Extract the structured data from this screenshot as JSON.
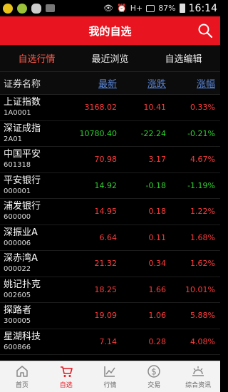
{
  "status_bar": {
    "battery": "87%",
    "time": "16:14",
    "network": "H+",
    "icons": [
      "warning-icon",
      "ball-icon",
      "wechat-icon",
      "image-icon",
      "eye-icon",
      "alarm-icon",
      "wifi-icon",
      "signal-icon",
      "battery-icon"
    ]
  },
  "header": {
    "title": "我的自选",
    "search_icon": "search-icon"
  },
  "tabs": [
    {
      "label": "自选行情",
      "active": true
    },
    {
      "label": "最近浏览",
      "active": false
    },
    {
      "label": "自选编辑",
      "active": false
    }
  ],
  "columns": {
    "name": "证券名称",
    "latest": "最新",
    "change": "涨跌",
    "change_pct": "涨幅"
  },
  "stocks": [
    {
      "name": "上证指数",
      "code": "1A0001",
      "latest": "3168.02",
      "change": "10.41",
      "pct": "0.33%",
      "dir": "up"
    },
    {
      "name": "深证成指",
      "code": "2A01",
      "latest": "10780.40",
      "change": "-22.24",
      "pct": "-0.21%",
      "dir": "down"
    },
    {
      "name": "中国平安",
      "code": "601318",
      "latest": "70.98",
      "change": "3.17",
      "pct": "4.67%",
      "dir": "up"
    },
    {
      "name": "平安银行",
      "code": "000001",
      "latest": "14.92",
      "change": "-0.18",
      "pct": "-1.19%",
      "dir": "down"
    },
    {
      "name": "浦发银行",
      "code": "600000",
      "latest": "14.95",
      "change": "0.18",
      "pct": "1.22%",
      "dir": "up"
    },
    {
      "name": "深振业A",
      "code": "000006",
      "latest": "6.64",
      "change": "0.11",
      "pct": "1.68%",
      "dir": "up"
    },
    {
      "name": "深赤湾A",
      "code": "000022",
      "latest": "21.32",
      "change": "0.34",
      "pct": "1.62%",
      "dir": "up"
    },
    {
      "name": "姚记扑克",
      "code": "002605",
      "latest": "18.25",
      "change": "1.66",
      "pct": "10.01%",
      "dir": "up"
    },
    {
      "name": "探路者",
      "code": "300005",
      "latest": "19.09",
      "change": "1.06",
      "pct": "5.88%",
      "dir": "up"
    },
    {
      "name": "星湖科技",
      "code": "600866",
      "latest": "7.14",
      "change": "0.28",
      "pct": "4.08%",
      "dir": "up"
    }
  ],
  "bottom_nav": [
    {
      "label": "首页",
      "icon": "home-icon",
      "active": false
    },
    {
      "label": "自选",
      "icon": "cart-icon",
      "active": true
    },
    {
      "label": "行情",
      "icon": "trend-chart-icon",
      "active": false
    },
    {
      "label": "交易",
      "icon": "dollar-coin-icon",
      "active": false
    },
    {
      "label": "综合资讯",
      "icon": "news-sun-icon",
      "active": false
    }
  ],
  "colors": {
    "brand": "#e8141f",
    "up": "#ff3b3b",
    "down": "#2ed12e",
    "link": "#5b86d6",
    "active_tab": "#ff5a4a"
  }
}
